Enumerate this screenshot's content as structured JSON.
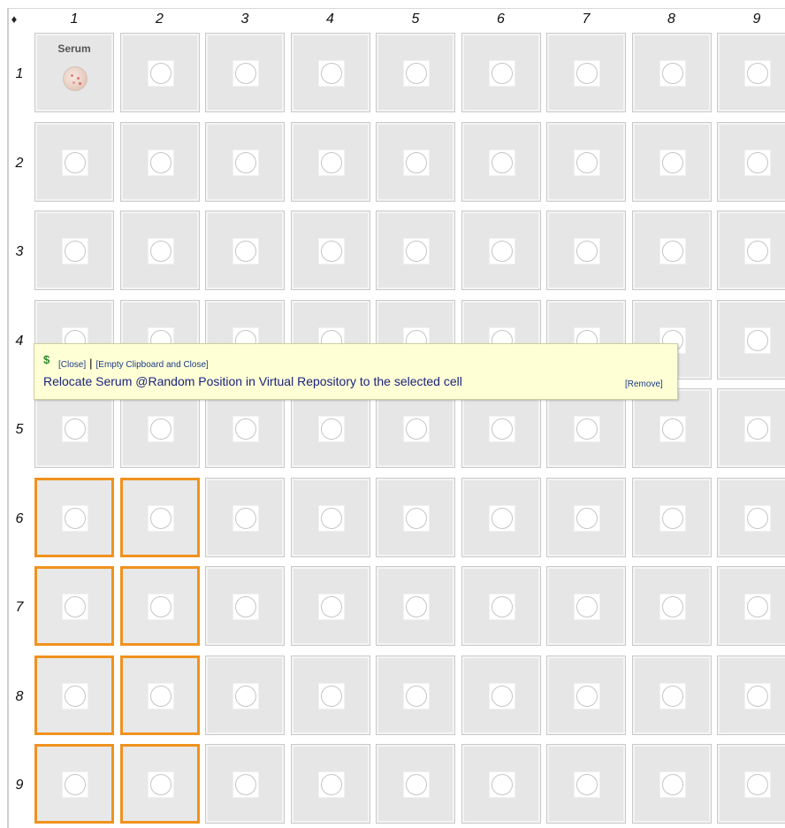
{
  "grid": {
    "corner_symbol": "♦",
    "column_headers": [
      "1",
      "2",
      "3",
      "4",
      "5",
      "6",
      "7",
      "8",
      "9"
    ],
    "row_headers": [
      "1",
      "2",
      "3",
      "4",
      "5",
      "6",
      "7",
      "8",
      "9"
    ],
    "occupied_cells": [
      {
        "row": 1,
        "col": 1,
        "label": "Serum"
      }
    ],
    "selected_cells": [
      [
        6,
        1
      ],
      [
        6,
        2
      ],
      [
        7,
        1
      ],
      [
        7,
        2
      ],
      [
        8,
        1
      ],
      [
        8,
        2
      ],
      [
        9,
        1
      ],
      [
        9,
        2
      ]
    ],
    "empty_well_icon": "empty-well-circle",
    "sample_icon": "sample-tube-dots",
    "colors": {
      "cell_background": "#e6e6e6",
      "selection_border": "#f0921e",
      "popup_background": "#ffffd6",
      "link_color": "#1a3a8a"
    }
  },
  "clipboard_popup": {
    "icon": "relocate-icon",
    "close_link": "[Close]",
    "separator": "|",
    "empty_close_link": "[Empty Clipboard and Close]",
    "message": "Relocate Serum @Random Position in Virtual Repository to the selected cell",
    "remove_link": "[Remove]"
  }
}
